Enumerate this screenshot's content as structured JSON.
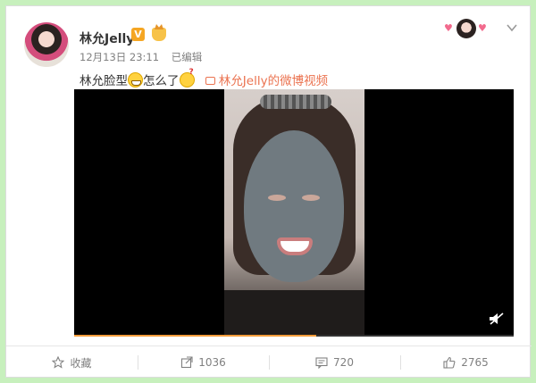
{
  "post": {
    "username": "林允Jelly",
    "verified_badge": "V",
    "timestamp": "12月13日 23:11",
    "edited_label": "已编辑",
    "text_before_emoji": "林允脸型",
    "text_after_emoji": "怎么了",
    "video_link": "林允Jelly的微博视频",
    "icons": {
      "verified": "verified-v-icon",
      "member": "crown-icon",
      "emoji1": "grin-emoji",
      "emoji2": "puzzled-emoji",
      "video": "video-icon",
      "more": "chevron-down-icon"
    }
  },
  "video": {
    "progress_percent": 55,
    "progress_color": "#f39c3b",
    "mute_icon": "speaker-muted-icon"
  },
  "actions": {
    "favorite": {
      "label": "收藏",
      "icon": "star-icon"
    },
    "repost": {
      "count": "1036",
      "icon": "repost-icon"
    },
    "comment": {
      "count": "720",
      "icon": "comment-icon"
    },
    "like": {
      "count": "2765",
      "icon": "thumbs-up-icon"
    }
  },
  "colors": {
    "background": "#c7f0bd",
    "link": "#eb7350",
    "badge": "#f5a623"
  }
}
